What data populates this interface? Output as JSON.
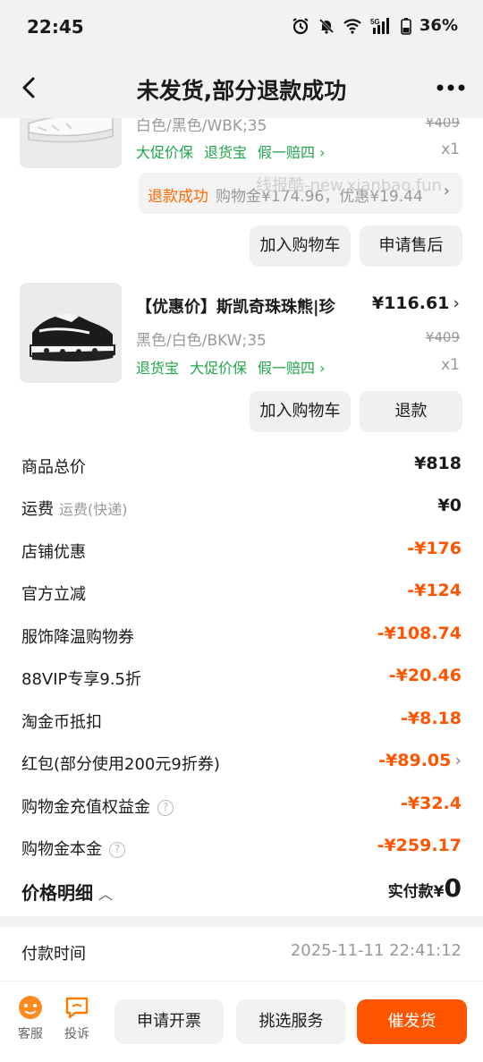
{
  "status_bar": {
    "time": "22:45",
    "battery": "36%"
  },
  "nav": {
    "title": "未发货,部分退款成功"
  },
  "item1": {
    "sku": "白色/黑色/WBK;35",
    "orig_price": "¥409",
    "tags": [
      "大促价保",
      "退货宝",
      "假一赔四 ›"
    ],
    "qty": "x1",
    "refund_status": "退款成功",
    "refund_detail": "购物金¥174.96，优惠¥19.44",
    "watermark": "线报酷-new.xianbao.fun",
    "btn_cart": "加入购物车",
    "btn_after": "申请售后"
  },
  "item2": {
    "title": "【优惠价】斯凯奇珠珠熊|珍",
    "price": "¥116.61",
    "sku": "黑色/白色/BKW;35",
    "orig_price": "¥409",
    "tags": [
      "退货宝",
      "大促价保",
      "假一赔四 ›"
    ],
    "qty": "x1",
    "btn_cart": "加入购物车",
    "btn_refund": "退款"
  },
  "price_rows": [
    {
      "label": "商品总价",
      "sub": "",
      "value": "¥818",
      "neg": false
    },
    {
      "label": "运费",
      "sub": "运费(快递)",
      "value": "¥0",
      "neg": false
    },
    {
      "label": "店铺优惠",
      "sub": "",
      "value": "-¥176",
      "neg": true
    },
    {
      "label": "官方立减",
      "sub": "",
      "value": "-¥124",
      "neg": true
    },
    {
      "label": "服饰降温购物券",
      "sub": "",
      "value": "-¥108.74",
      "neg": true
    },
    {
      "label": "88VIP专享9.5折",
      "sub": "",
      "value": "-¥20.46",
      "neg": true
    },
    {
      "label": "淘金币抵扣",
      "sub": "",
      "value": "-¥8.18",
      "neg": true
    },
    {
      "label": "红包(部分使用200元9折券)",
      "sub": "",
      "value": "-¥89.05",
      "neg": true
    },
    {
      "label": "购物金充值权益金",
      "sub": "",
      "value": "-¥32.4",
      "neg": true
    },
    {
      "label": "购物金本金",
      "sub": "",
      "value": "-¥259.17",
      "neg": true
    }
  ],
  "price_detail": {
    "label": "价格明细",
    "paid_label": "实付款¥",
    "paid_value": "0"
  },
  "pay_time": {
    "label": "付款时间",
    "value": "2025-11-11 22:41:12"
  },
  "bottom": {
    "service_label": "客服",
    "complain_label": "投诉",
    "invoice": "申请开票",
    "choose_service": "挑选服务",
    "urge": "催发货"
  },
  "colors": {
    "accent": "#ff5500",
    "green": "#1fa64a"
  }
}
